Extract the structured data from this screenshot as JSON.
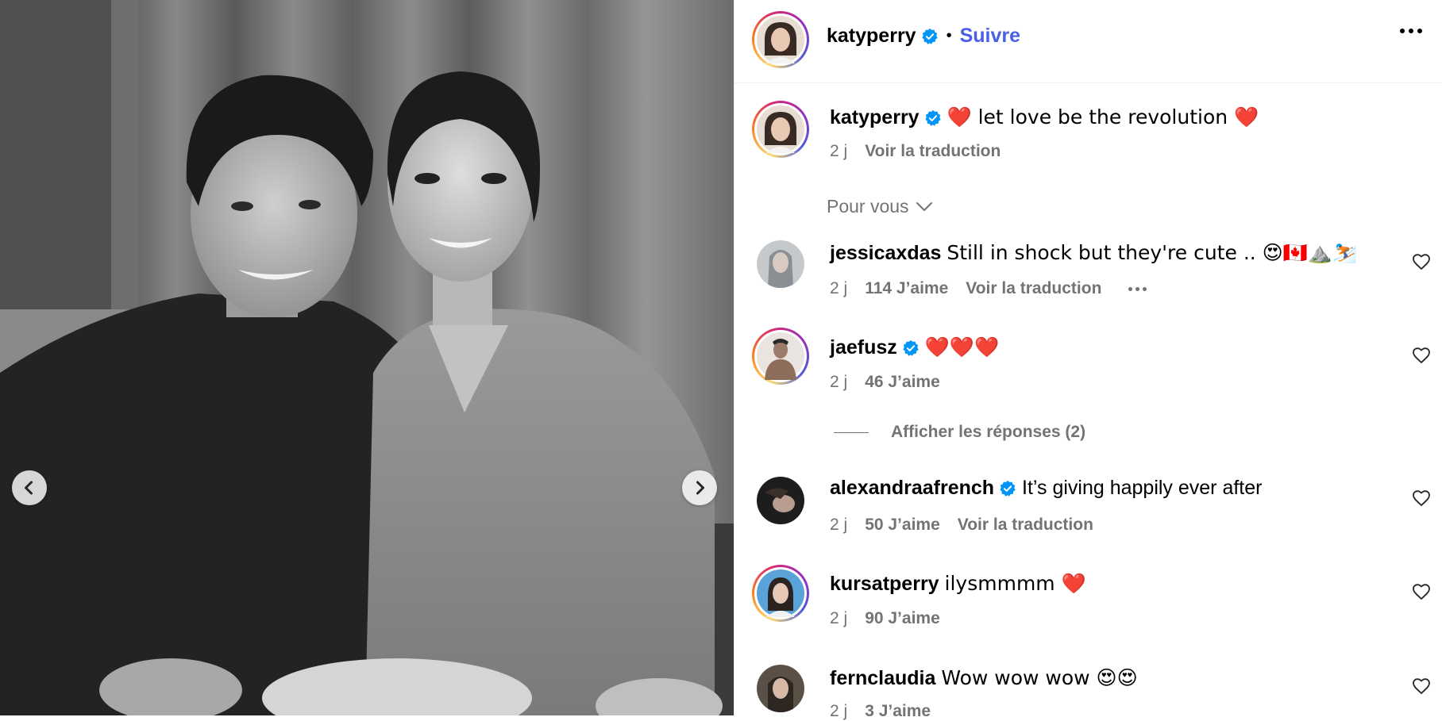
{
  "post": {
    "author": "katyperry",
    "follow_label": "Suivre",
    "caption": {
      "username": "katyperry",
      "text": "❤️ let love be the revolution ❤️",
      "time": "2 j",
      "translate": "Voir la traduction"
    }
  },
  "for_you_label": "Pour vous",
  "comments": [
    {
      "username": "jessicaxdas",
      "text": "Still in shock but they're cute .. 😍🇨🇦⛰️⛷️",
      "time": "2 j",
      "likes": "114 J’aime",
      "translate": "Voir la traduction",
      "verified": false
    },
    {
      "username": "jaefusz",
      "text": "❤️❤️❤️",
      "time": "2 j",
      "likes": "46 J’aime",
      "verified": true
    },
    {
      "username": "alexandraafrench",
      "text": "It’s giving happily ever after",
      "time": "2 j",
      "likes": "50 J’aime",
      "translate": "Voir la traduction",
      "verified": true
    },
    {
      "username": "kursatperry",
      "text": "ilysmmmm ❤️",
      "time": "2 j",
      "likes": "90 J’aime",
      "verified": false
    },
    {
      "username": "fernclaudia",
      "text": "Wow wow wow 😍😍",
      "time": "2 j",
      "likes": "3 J’aime",
      "verified": false
    }
  ],
  "show_replies_label": "Afficher les réponses (2)",
  "icons": {
    "verified": "verified-badge-icon",
    "like": "heart-outline-icon",
    "prev": "chevron-left-icon",
    "next": "chevron-right-icon",
    "more": "more-horizontal-icon",
    "dropdown": "chevron-down-icon"
  },
  "colors": {
    "follow": "#4a5ee8",
    "verified": "#0095f6",
    "muted": "#737373"
  }
}
